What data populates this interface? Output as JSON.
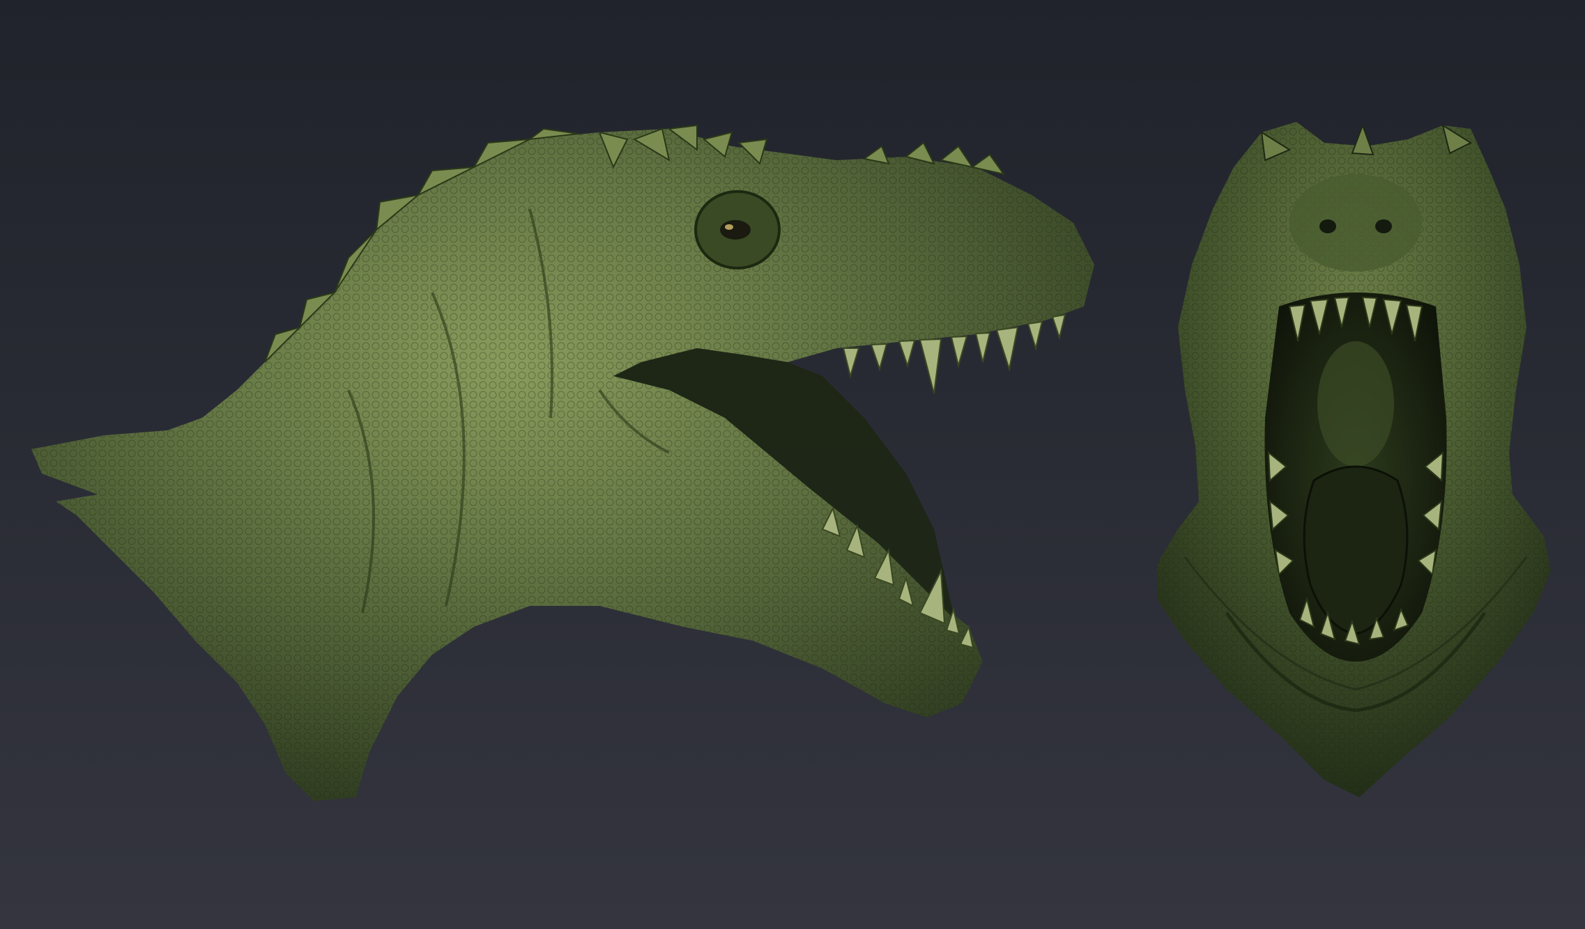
{
  "scene": {
    "background_top": "#20232b",
    "background_bottom": "#34353f",
    "skin_light": "#8a9c5c",
    "skin_mid": "#56683a",
    "skin_dark": "#1e2814",
    "mouth_dark": "#141a0e",
    "teeth": "#a8b47e",
    "eye": "#d8c070"
  },
  "models": [
    {
      "name": "side-view-head",
      "view": "side"
    },
    {
      "name": "front-view-head",
      "view": "front"
    }
  ]
}
